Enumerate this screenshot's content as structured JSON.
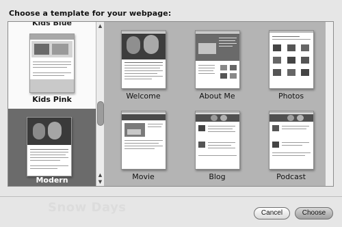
{
  "dialog": {
    "prompt": "Choose a template for your webpage:",
    "watermark_text": "Snow Days"
  },
  "themes": {
    "partial_top": "Kids Blue",
    "items": [
      {
        "label": "Kids Pink",
        "selected": false
      },
      {
        "label": "Modern",
        "selected": true
      }
    ]
  },
  "templates": [
    {
      "label": "Welcome"
    },
    {
      "label": "About Me"
    },
    {
      "label": "Photos"
    },
    {
      "label": "Movie"
    },
    {
      "label": "Blog"
    },
    {
      "label": "Podcast"
    }
  ],
  "buttons": {
    "cancel": "Cancel",
    "choose": "Choose"
  },
  "colors": {
    "selected_theme_bg": "#6b6b6b",
    "grid_bg": "#b4b4b4"
  }
}
